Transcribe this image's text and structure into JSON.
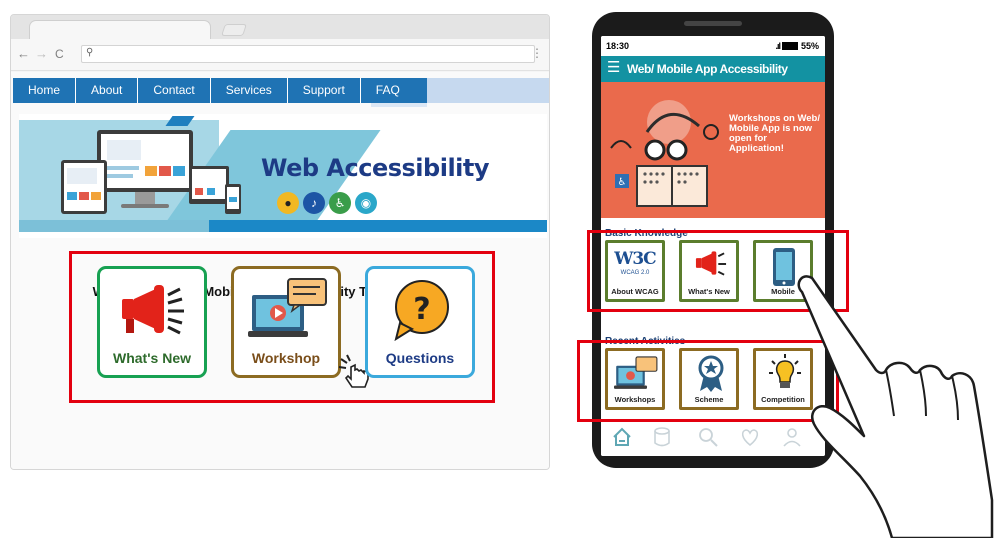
{
  "browser": {
    "nav": {
      "back": "←",
      "forward": "→",
      "reload": "C",
      "search_glyph": "⚲"
    },
    "menu": [
      "Home",
      "About",
      "Contact",
      "Services",
      "Support",
      "FAQ"
    ],
    "banner_title": "Web Accessibility",
    "welcome": "Welcome to Web/ Mobile App Accessibility Thematic Website",
    "cards": [
      {
        "label": "What's New",
        "color": "#17a152",
        "text_color": "#2e6b2c"
      },
      {
        "label": "Workshop",
        "color": "#8c6b22",
        "text_color": "#7a4e1a"
      },
      {
        "label": "Questions",
        "color": "#3ba9dc",
        "text_color": "#1d3b85"
      }
    ]
  },
  "phone": {
    "time": "18:30",
    "battery": "55%",
    "app_title": "Web/ Mobile App Accessibility",
    "promo": "Workshops on Web/ Mobile App is now open for Application!",
    "basic_label": "Basic Knowledge",
    "basic_cards": [
      {
        "label": "About WCAG",
        "color": "#5b7d2d"
      },
      {
        "label": "What's New",
        "color": "#5b7d2d"
      },
      {
        "label": "Mobile",
        "color": "#5b7d2d"
      }
    ],
    "w3c": {
      "logo": "W3C",
      "sub": "WCAG 2.0"
    },
    "recent_label": "Recent Activities",
    "recent_cards": [
      {
        "label": "Workshops",
        "color": "#8c6b22"
      },
      {
        "label": "Scheme",
        "color": "#8c6b22"
      },
      {
        "label": "Competition",
        "color": "#8c6b22"
      }
    ]
  },
  "accent": {
    "red_outline": "#e3000f",
    "menu_blue": "#1f73b4",
    "app_teal": "#1392a2",
    "promo_orange": "#ea6a4c"
  }
}
